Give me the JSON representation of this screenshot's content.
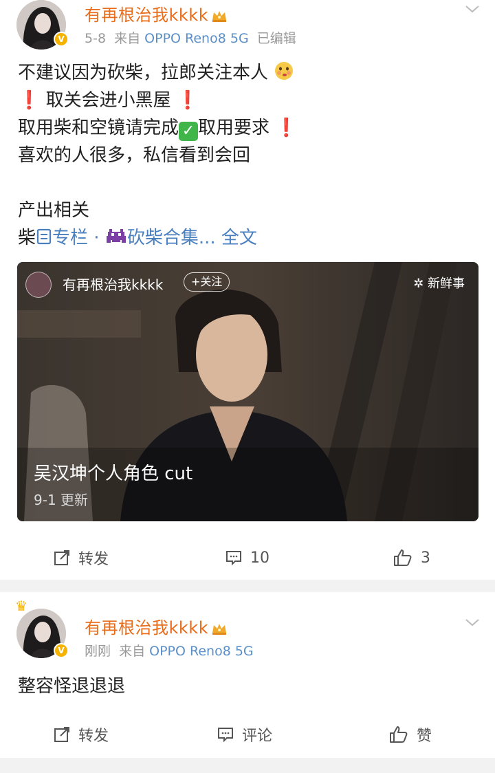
{
  "post1": {
    "username": "有再根治我kkkk",
    "date": "5-8",
    "source_prefix": "来自",
    "source_device": "OPPO Reno8 5G",
    "edited": "已编辑",
    "lines": {
      "l1": "不建议因为砍柴，拉郎关注本人",
      "l2": "取关会进小黑屋",
      "l3a": "取用柴和空镜请完成",
      "l3b": "取用要求",
      "l4": "喜欢的人很多，私信看到会回",
      "l5": "产出相关",
      "l6a": "柴",
      "l6b": "专栏",
      "l6c": " · ",
      "l6d": "砍柴合集...",
      "l6e": " 全文"
    },
    "media": {
      "author": "有再根治我kkkk",
      "follow_label": "+关注",
      "channel": "新鲜事",
      "title": "吴汉坤个人角色 cut",
      "subtitle": "9-1 更新"
    },
    "actions": {
      "repost": "转发",
      "comment_count": "10",
      "like_count": "3"
    }
  },
  "post2": {
    "username": "有再根治我kkkk",
    "time": "刚刚",
    "source_prefix": "来自",
    "source_device": "OPPO Reno8 5G",
    "text": "整容怪退退退",
    "actions": {
      "repost": "转发",
      "comment": "评论",
      "like": "赞"
    }
  },
  "colors": {
    "username": "#e86c1a",
    "link": "#4a7fbf",
    "vip_badge": "#f5b300"
  }
}
